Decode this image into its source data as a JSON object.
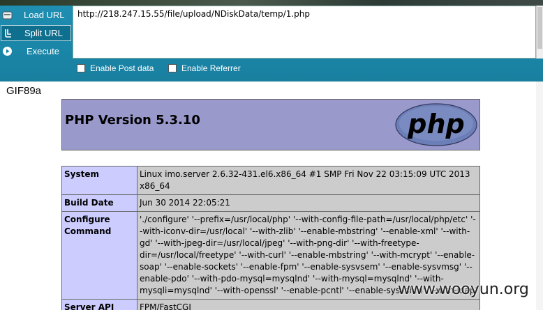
{
  "toolbar": {
    "load_label": "Load URL",
    "split_label": "Split URL",
    "execute_label": "Execute",
    "url_value": "http://218.247.15.55/file/upload/NDiskData/temp/1.php",
    "enable_post_label": "Enable Post data",
    "enable_referrer_label": "Enable Referrer"
  },
  "page": {
    "gif_text": "GIF89a",
    "php_version_title": "PHP Version 5.3.10",
    "logo_text": "php",
    "rows": [
      {
        "key": "System",
        "value": "Linux imo.server 2.6.32-431.el6.x86_64 #1 SMP Fri Nov 22 03:15:09 UTC 2013 x86_64"
      },
      {
        "key": "Build Date",
        "value": "Jun 30 2014 22:05:21"
      },
      {
        "key": "Configure Command",
        "value": "'./configure' '--prefix=/usr/local/php' '--with-config-file-path=/usr/local/php/etc' '--with-iconv-dir=/usr/local' '--with-zlib' '--enable-mbstring' '--enable-xml' '--with-gd' '--with-jpeg-dir=/usr/local/jpeg' '--with-png-dir' '--with-freetype-dir=/usr/local/freetype' '--with-curl' '--enable-mbstring' '--with-mcrypt' '--enable-soap' '--enable-sockets' '--enable-fpm' '--enable-sysvsem' '--enable-sysvmsg' '--enable-pdo' '--with-pdo-mysql=mysqlnd' '--with-mysql=mysqlnd' '--with-mysqli=mysqlnd' '--with-openssl' '--enable-pcntl' '--enable-sysvshm' '--with-ldap'"
      },
      {
        "key": "Server API",
        "value": "FPM/FastCGI"
      }
    ]
  },
  "watermark": "www.wooyun.org",
  "colors": {
    "toolbar": "#1a86a8",
    "php_header": "#9999cc",
    "key_cell": "#ccccff",
    "value_cell": "#cccccc"
  }
}
